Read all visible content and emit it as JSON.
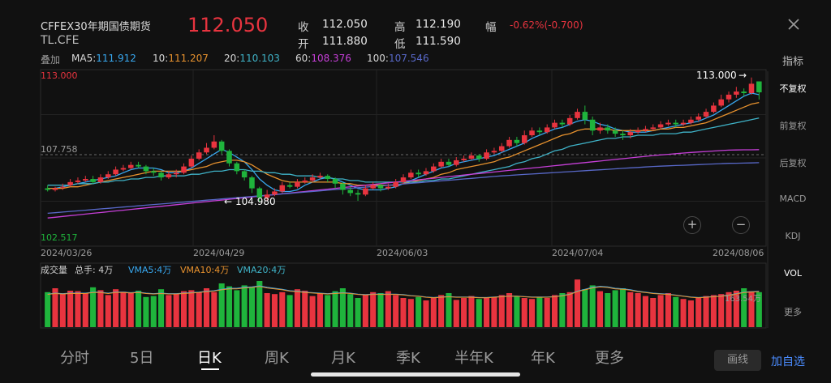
{
  "header": {
    "title": "CFFEX30年期国债期货",
    "code": "TL.CFE",
    "price": "112.050",
    "close_label": "收",
    "close_value": "112.050",
    "open_label": "开",
    "open_value": "111.880",
    "high_label": "高",
    "high_value": "112.190",
    "low_label": "低",
    "low_value": "111.590",
    "amp_label": "幅",
    "amp_value": "-0.62%(-0.700)"
  },
  "ma": {
    "overlay_label": "叠加",
    "items": [
      {
        "label": "MA5:",
        "value": "111.912",
        "color": "#38a8f0"
      },
      {
        "label": "10:",
        "value": "111.207",
        "color": "#e8922e"
      },
      {
        "label": "20:",
        "value": "110.103",
        "color": "#3fb3c8"
      },
      {
        "label": "60:",
        "value": "108.376",
        "color": "#c63fd8"
      },
      {
        "label": "100:",
        "value": "107.546",
        "color": "#5868c8"
      }
    ]
  },
  "price_axis": {
    "top": "113.000",
    "mid": "107.758",
    "bottom": "102.517"
  },
  "annotations": {
    "high_mark": "113.000",
    "low_mark": "104.980"
  },
  "dates": [
    "2024/03/26",
    "2024/04/29",
    "2024/06/03",
    "2024/07/04",
    "2024/08/06"
  ],
  "volume": {
    "title": "成交量",
    "total": "总手: 4万",
    "vma5": "VMA5:4万",
    "vma10": "VMA10:4万",
    "vma20": "VMA20:4万",
    "axis_label": "163.54万"
  },
  "right_panel": {
    "indicator": "指标",
    "items": [
      "不复权",
      "前复权",
      "后复权",
      "MACD",
      "KDJ",
      "VOL",
      "更多"
    ],
    "active": "不复权",
    "zoom_in": "+",
    "zoom_out": "−"
  },
  "tabs": {
    "items": [
      "分时",
      "5日",
      "日K",
      "周K",
      "月K",
      "季K",
      "半年K",
      "年K",
      "更多"
    ],
    "active": "日K"
  },
  "buttons": {
    "draw": "画线",
    "add": "加自选"
  },
  "colors": {
    "up": "#e8343f",
    "down": "#1fb43c",
    "background": "#111111"
  },
  "chart_data": {
    "type": "candlestick",
    "series_candles": [
      [
        105.9,
        105.8,
        106.1,
        105.7
      ],
      [
        105.8,
        105.9,
        106.0,
        105.7
      ],
      [
        105.95,
        106.0,
        106.2,
        105.8
      ],
      [
        106.1,
        106.3,
        106.5,
        106.0
      ],
      [
        106.3,
        106.4,
        106.6,
        106.2
      ],
      [
        106.4,
        106.5,
        106.7,
        106.3
      ],
      [
        106.5,
        106.3,
        106.7,
        106.2
      ],
      [
        106.3,
        106.6,
        106.8,
        106.2
      ],
      [
        106.6,
        106.8,
        107.0,
        106.5
      ],
      [
        106.8,
        107.1,
        107.3,
        106.7
      ],
      [
        107.1,
        107.2,
        107.4,
        107.0
      ],
      [
        107.2,
        107.4,
        107.6,
        107.1
      ],
      [
        107.4,
        107.3,
        107.6,
        107.2
      ],
      [
        107.3,
        107.0,
        107.4,
        106.8
      ],
      [
        107.0,
        106.9,
        107.2,
        106.7
      ],
      [
        106.9,
        106.6,
        107.0,
        106.4
      ],
      [
        106.6,
        106.8,
        107.0,
        106.5
      ],
      [
        106.8,
        106.9,
        107.1,
        106.6
      ],
      [
        106.9,
        107.3,
        107.5,
        106.8
      ],
      [
        107.3,
        107.8,
        108.0,
        107.2
      ],
      [
        107.8,
        108.2,
        108.4,
        107.7
      ],
      [
        108.2,
        108.5,
        108.8,
        108.1
      ],
      [
        108.5,
        108.9,
        109.3,
        108.4
      ],
      [
        108.9,
        108.3,
        109.0,
        108.1
      ],
      [
        108.3,
        107.5,
        108.4,
        107.3
      ],
      [
        107.5,
        107.0,
        107.6,
        106.8
      ],
      [
        107.0,
        106.6,
        107.1,
        106.4
      ],
      [
        106.6,
        105.9,
        106.7,
        105.6
      ],
      [
        105.9,
        105.3,
        106.0,
        105.0
      ],
      [
        105.3,
        105.5,
        105.8,
        105.1
      ],
      [
        105.5,
        105.7,
        105.9,
        105.4
      ],
      [
        105.7,
        106.1,
        106.3,
        105.6
      ],
      [
        106.1,
        106.0,
        106.3,
        105.9
      ],
      [
        106.0,
        106.3,
        106.5,
        105.9
      ],
      [
        106.3,
        106.4,
        106.6,
        106.2
      ],
      [
        106.4,
        106.6,
        106.8,
        106.3
      ],
      [
        106.6,
        106.7,
        106.9,
        106.5
      ],
      [
        106.7,
        106.5,
        106.8,
        106.3
      ],
      [
        106.5,
        106.2,
        106.6,
        105.9
      ],
      [
        106.2,
        105.8,
        106.3,
        105.5
      ],
      [
        105.8,
        105.6,
        106.0,
        105.4
      ],
      [
        105.6,
        105.5,
        105.8,
        105.1
      ],
      [
        105.5,
        105.9,
        106.1,
        105.4
      ],
      [
        105.9,
        106.1,
        106.3,
        105.8
      ],
      [
        106.1,
        105.9,
        106.2,
        105.7
      ],
      [
        105.9,
        106.0,
        106.2,
        105.8
      ],
      [
        106.0,
        106.3,
        106.5,
        105.9
      ],
      [
        106.3,
        106.6,
        106.8,
        106.2
      ],
      [
        106.6,
        106.9,
        107.1,
        106.5
      ],
      [
        106.9,
        106.8,
        107.1,
        106.6
      ],
      [
        106.8,
        107.0,
        107.2,
        106.7
      ],
      [
        107.0,
        107.3,
        107.5,
        106.9
      ],
      [
        107.3,
        107.6,
        107.8,
        107.2
      ],
      [
        107.6,
        107.4,
        107.8,
        107.3
      ],
      [
        107.4,
        107.7,
        107.9,
        107.3
      ],
      [
        107.7,
        107.8,
        108.0,
        107.6
      ],
      [
        107.8,
        108.0,
        108.2,
        107.7
      ],
      [
        108.0,
        107.8,
        108.1,
        107.6
      ],
      [
        107.8,
        108.2,
        108.4,
        107.7
      ],
      [
        108.2,
        108.3,
        108.5,
        108.1
      ],
      [
        108.3,
        108.6,
        108.8,
        108.2
      ],
      [
        108.6,
        109.0,
        109.2,
        108.5
      ],
      [
        109.0,
        108.8,
        109.2,
        108.6
      ],
      [
        108.8,
        109.3,
        109.6,
        108.7
      ],
      [
        109.3,
        109.6,
        109.8,
        109.2
      ],
      [
        109.6,
        109.5,
        109.8,
        109.3
      ],
      [
        109.5,
        109.8,
        110.0,
        109.4
      ],
      [
        109.8,
        110.1,
        110.3,
        109.7
      ],
      [
        110.1,
        110.0,
        110.3,
        109.8
      ],
      [
        110.0,
        110.4,
        110.6,
        109.9
      ],
      [
        110.4,
        110.8,
        111.0,
        110.3
      ],
      [
        110.8,
        110.3,
        111.2,
        110.0
      ],
      [
        110.3,
        109.6,
        110.5,
        109.3
      ],
      [
        109.6,
        109.8,
        110.1,
        109.4
      ],
      [
        109.8,
        109.6,
        110.0,
        109.4
      ],
      [
        109.6,
        109.4,
        109.8,
        109.2
      ],
      [
        109.4,
        109.3,
        109.6,
        109.0
      ],
      [
        109.3,
        109.5,
        109.7,
        109.1
      ],
      [
        109.5,
        109.6,
        109.8,
        109.4
      ],
      [
        109.6,
        109.7,
        109.9,
        109.5
      ],
      [
        109.7,
        109.8,
        110.0,
        109.6
      ],
      [
        109.8,
        110.0,
        110.2,
        109.7
      ],
      [
        110.0,
        110.1,
        110.3,
        109.9
      ],
      [
        110.1,
        110.0,
        110.3,
        109.8
      ],
      [
        110.0,
        110.1,
        110.3,
        109.9
      ],
      [
        110.1,
        110.3,
        110.5,
        110.0
      ],
      [
        110.3,
        110.5,
        110.7,
        110.2
      ],
      [
        110.5,
        110.8,
        111.0,
        110.4
      ],
      [
        110.8,
        111.2,
        111.4,
        110.7
      ],
      [
        111.2,
        111.6,
        111.9,
        111.1
      ],
      [
        111.6,
        111.9,
        112.1,
        111.4
      ],
      [
        111.9,
        112.1,
        112.4,
        111.7
      ],
      [
        112.1,
        112.0,
        112.3,
        111.8
      ],
      [
        112.0,
        112.6,
        113.0,
        111.9
      ],
      [
        112.75,
        112.05,
        112.19,
        111.59
      ]
    ],
    "series_ma": {
      "MA5": [
        105.9,
        105.9,
        106.0,
        106.1,
        106.2,
        106.3,
        106.4,
        106.5,
        106.6,
        106.7,
        106.9,
        107.1,
        107.2,
        107.2,
        107.2,
        107.1,
        106.9,
        106.9,
        107.0,
        107.2,
        107.5,
        107.8,
        108.1,
        108.4,
        108.2,
        107.9,
        107.6,
        107.1,
        106.5,
        106.1,
        105.8,
        105.7,
        105.7,
        105.8,
        106.1,
        106.3,
        106.5,
        106.6,
        106.5,
        106.3,
        106.1,
        105.9,
        105.8,
        105.8,
        105.8,
        105.9,
        106.0,
        106.2,
        106.4,
        106.6,
        106.8,
        107.0,
        107.2,
        107.3,
        107.5,
        107.6,
        107.7,
        107.8,
        107.9,
        108.0,
        108.2,
        108.4,
        108.6,
        108.8,
        109.1,
        109.3,
        109.5,
        109.7,
        109.8,
        110.0,
        110.2,
        110.3,
        110.2,
        110.0,
        109.9,
        109.7,
        109.6,
        109.5,
        109.5,
        109.5,
        109.6,
        109.7,
        109.8,
        109.9,
        110.0,
        110.1,
        110.2,
        110.4,
        110.6,
        110.9,
        111.2,
        111.5,
        111.8,
        112.0,
        111.9
      ],
      "MA10": [
        105.9,
        105.9,
        105.9,
        106.0,
        106.0,
        106.1,
        106.2,
        106.3,
        106.4,
        106.5,
        106.6,
        106.7,
        106.8,
        106.9,
        107.0,
        107.0,
        107.0,
        107.0,
        107.0,
        107.1,
        107.2,
        107.3,
        107.5,
        107.6,
        107.7,
        107.7,
        107.6,
        107.4,
        107.1,
        106.8,
        106.6,
        106.4,
        106.3,
        106.3,
        106.3,
        106.3,
        106.3,
        106.3,
        106.3,
        106.2,
        106.2,
        106.1,
        106.1,
        106.1,
        106.1,
        106.1,
        106.1,
        106.2,
        106.3,
        106.4,
        106.5,
        106.6,
        106.8,
        106.9,
        107.1,
        107.2,
        107.3,
        107.4,
        107.5,
        107.6,
        107.8,
        107.9,
        108.1,
        108.3,
        108.5,
        108.7,
        108.9,
        109.1,
        109.3,
        109.4,
        109.6,
        109.7,
        109.7,
        109.7,
        109.7,
        109.6,
        109.6,
        109.6,
        109.6,
        109.6,
        109.6,
        109.7,
        109.7,
        109.8,
        109.8,
        109.9,
        110.0,
        110.1,
        110.3,
        110.5,
        110.7,
        110.9,
        111.1,
        111.3,
        111.4
      ],
      "MA20": [
        106.1,
        106.1,
        106.1,
        106.1,
        106.2,
        106.2,
        106.2,
        106.3,
        106.3,
        106.4,
        106.4,
        106.5,
        106.5,
        106.6,
        106.6,
        106.7,
        106.7,
        106.7,
        106.7,
        106.8,
        106.8,
        106.9,
        107.0,
        107.0,
        107.1,
        107.1,
        107.1,
        107.0,
        107.0,
        106.9,
        106.9,
        106.8,
        106.8,
        106.7,
        106.7,
        106.7,
        106.6,
        106.6,
        106.5,
        106.5,
        106.4,
        106.4,
        106.3,
        106.3,
        106.3,
        106.3,
        106.3,
        106.3,
        106.3,
        106.3,
        106.4,
        106.4,
        106.5,
        106.5,
        106.6,
        106.7,
        106.8,
        106.9,
        107.0,
        107.1,
        107.2,
        107.3,
        107.5,
        107.6,
        107.8,
        107.9,
        108.1,
        108.3,
        108.4,
        108.6,
        108.7,
        108.8,
        108.9,
        109.0,
        109.1,
        109.1,
        109.2,
        109.2,
        109.3,
        109.3,
        109.3,
        109.4,
        109.4,
        109.4,
        109.5,
        109.5,
        109.6,
        109.7,
        109.8,
        109.9,
        110.0,
        110.1,
        110.2,
        110.3,
        110.4
      ],
      "MA60": [
        104.0,
        104.05,
        104.1,
        104.15,
        104.2,
        104.25,
        104.3,
        104.35,
        104.4,
        104.45,
        104.5,
        104.55,
        104.6,
        104.65,
        104.7,
        104.75,
        104.8,
        104.85,
        104.9,
        104.95,
        105.0,
        105.05,
        105.1,
        105.15,
        105.2,
        105.25,
        105.3,
        105.35,
        105.4,
        105.45,
        105.5,
        105.55,
        105.6,
        105.65,
        105.7,
        105.75,
        105.8,
        105.85,
        105.9,
        105.95,
        106.0,
        106.05,
        106.1,
        106.15,
        106.2,
        106.25,
        106.3,
        106.35,
        106.4,
        106.45,
        106.5,
        106.55,
        106.6,
        106.65,
        106.7,
        106.75,
        106.8,
        106.85,
        106.9,
        106.95,
        107.0,
        107.05,
        107.1,
        107.15,
        107.2,
        107.25,
        107.3,
        107.35,
        107.4,
        107.45,
        107.5,
        107.55,
        107.6,
        107.65,
        107.7,
        107.75,
        107.8,
        107.85,
        107.9,
        107.95,
        108.0,
        108.04,
        108.08,
        108.12,
        108.16,
        108.2,
        108.23,
        108.26,
        108.29,
        108.32,
        108.35,
        108.36,
        108.37,
        108.37,
        108.38
      ],
      "MA100": [
        104.3,
        104.34,
        104.38,
        104.42,
        104.46,
        104.5,
        104.54,
        104.58,
        104.62,
        104.66,
        104.7,
        104.74,
        104.78,
        104.82,
        104.86,
        104.9,
        104.94,
        104.98,
        105.02,
        105.06,
        105.1,
        105.14,
        105.18,
        105.22,
        105.26,
        105.3,
        105.34,
        105.38,
        105.42,
        105.46,
        105.5,
        105.54,
        105.58,
        105.62,
        105.66,
        105.7,
        105.74,
        105.78,
        105.82,
        105.86,
        105.9,
        105.94,
        105.98,
        106.02,
        106.06,
        106.1,
        106.14,
        106.18,
        106.22,
        106.26,
        106.3,
        106.34,
        106.38,
        106.42,
        106.46,
        106.5,
        106.54,
        106.58,
        106.62,
        106.66,
        106.7,
        106.73,
        106.76,
        106.79,
        106.82,
        106.85,
        106.88,
        106.91,
        106.94,
        106.97,
        107.0,
        107.03,
        107.06,
        107.09,
        107.12,
        107.15,
        107.18,
        107.21,
        107.24,
        107.27,
        107.3,
        107.32,
        107.34,
        107.36,
        107.38,
        107.4,
        107.42,
        107.44,
        107.46,
        107.48,
        107.5,
        107.51,
        107.52,
        107.53,
        107.546
      ]
    },
    "volume_values": [
      0.72,
      0.8,
      0.68,
      0.75,
      0.74,
      0.7,
      0.82,
      0.76,
      0.66,
      0.78,
      0.73,
      0.7,
      0.75,
      0.62,
      0.64,
      0.78,
      0.66,
      0.69,
      0.74,
      0.76,
      0.71,
      0.8,
      0.72,
      0.9,
      0.84,
      0.76,
      0.86,
      0.82,
      0.95,
      0.7,
      0.68,
      0.72,
      0.66,
      0.78,
      0.75,
      0.64,
      0.7,
      0.66,
      0.74,
      0.8,
      0.68,
      0.6,
      0.66,
      0.72,
      0.7,
      0.74,
      0.66,
      0.6,
      0.58,
      0.62,
      0.55,
      0.6,
      0.66,
      0.7,
      0.56,
      0.6,
      0.64,
      0.58,
      0.6,
      0.62,
      0.66,
      0.7,
      0.64,
      0.6,
      0.58,
      0.62,
      0.6,
      0.66,
      0.7,
      0.72,
      0.98,
      0.78,
      0.86,
      0.74,
      0.7,
      0.76,
      0.8,
      0.72,
      0.7,
      0.64,
      0.6,
      0.66,
      0.7,
      0.62,
      0.58,
      0.55,
      0.6,
      0.64,
      0.66,
      0.68,
      0.72,
      0.75,
      0.8,
      0.74,
      0.72
    ],
    "vma_lines": [
      0.68,
      0.7,
      0.69,
      0.7,
      0.7,
      0.7,
      0.72,
      0.72,
      0.7,
      0.72,
      0.72,
      0.71,
      0.72,
      0.7,
      0.69,
      0.7,
      0.69,
      0.69,
      0.7,
      0.71,
      0.72,
      0.74,
      0.75,
      0.78,
      0.8,
      0.8,
      0.82,
      0.83,
      0.85,
      0.82,
      0.8,
      0.78,
      0.75,
      0.74,
      0.72,
      0.71,
      0.7,
      0.69,
      0.7,
      0.71,
      0.7,
      0.68,
      0.67,
      0.68,
      0.68,
      0.68,
      0.68,
      0.67,
      0.65,
      0.64,
      0.62,
      0.61,
      0.62,
      0.63,
      0.62,
      0.62,
      0.62,
      0.61,
      0.61,
      0.62,
      0.63,
      0.64,
      0.64,
      0.63,
      0.62,
      0.62,
      0.62,
      0.63,
      0.65,
      0.68,
      0.74,
      0.78,
      0.82,
      0.84,
      0.83,
      0.8,
      0.79,
      0.77,
      0.74,
      0.72,
      0.7,
      0.69,
      0.68,
      0.66,
      0.64,
      0.62,
      0.61,
      0.62,
      0.63,
      0.64,
      0.66,
      0.69,
      0.72,
      0.73,
      0.74
    ]
  }
}
